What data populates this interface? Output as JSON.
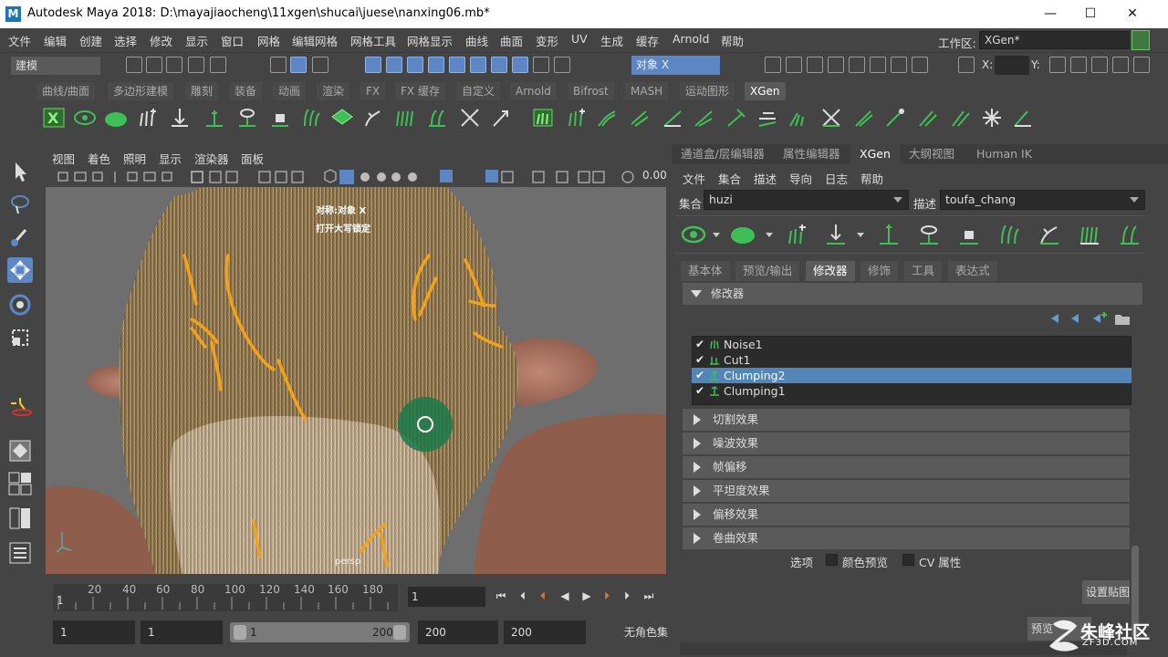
{
  "window": {
    "logo_letter": "M",
    "title": "Autodesk Maya 2018: D:\\mayajiaocheng\\11xgen\\shucai\\juese\\nanxing06.mb*",
    "minimize": "—",
    "maximize": "☐",
    "close": "✕"
  },
  "menubar": {
    "items": [
      "文件",
      "编辑",
      "创建",
      "选择",
      "修改",
      "显示",
      "窗口",
      "网格",
      "编辑网格",
      "网格工具",
      "网格显示",
      "曲线",
      "曲面",
      "变形",
      "UV",
      "生成",
      "缓存",
      "Arnold",
      "帮助"
    ],
    "workspace_label": "工作区:",
    "workspace_value": "XGen*"
  },
  "statusline": {
    "mode": "建模",
    "object_field": "对象 X",
    "x_label": "X:",
    "y_label": "Y:"
  },
  "shelf": {
    "tabs": [
      "曲线/曲面",
      "多边形建模",
      "雕刻",
      "装备",
      "动画",
      "渲染",
      "FX",
      "FX 缓存",
      "自定义",
      "Arnold",
      "Bifrost",
      "MASH",
      "运动图形",
      "XGen"
    ],
    "active_tab": "XGen"
  },
  "viewport": {
    "menu": [
      "视图",
      "着色",
      "照明",
      "显示",
      "渲染器",
      "面板"
    ],
    "zoom_value": "0.00",
    "hud_line1": "对称:对象 X",
    "hud_line2": "打开大写锁定",
    "camera_label": "persp"
  },
  "timeline": {
    "ticks": [
      "20",
      "40",
      "60",
      "80",
      "100",
      "120",
      "140",
      "160",
      "180"
    ],
    "start_marker": "1",
    "current_frame": "1"
  },
  "range": {
    "start": "1",
    "playback_start": "1",
    "slider_start": "1",
    "slider_end": "200",
    "playback_end": "200",
    "end": "200",
    "character_set": "无角色集"
  },
  "right_panel": {
    "tabs": [
      "通道盒/层编辑器",
      "属性编辑器",
      "XGen",
      "大纲视图",
      "Human IK"
    ],
    "active_tab": "XGen",
    "menu": [
      "文件",
      "集合",
      "描述",
      "导向",
      "日志",
      "帮助"
    ],
    "collection_label": "集合",
    "collection_value": "huzi",
    "description_label": "描述",
    "description_value": "toufa_chang",
    "sub_tabs": [
      "基本体",
      "预览/输出",
      "修改器",
      "修饰",
      "工具",
      "表达式"
    ],
    "active_sub_tab": "修改器",
    "modifier_header": "修改器",
    "modifiers": [
      {
        "name": "Noise1",
        "checked": "✔",
        "selected": false
      },
      {
        "name": "Cut1",
        "checked": "✔",
        "selected": false
      },
      {
        "name": "Clumping2",
        "checked": "✔",
        "selected": true
      },
      {
        "name": "Clumping1",
        "checked": "✔",
        "selected": false
      }
    ],
    "sections": [
      "切割效果",
      "噪波效果",
      "帧偏移",
      "平坦度效果",
      "偏移效果",
      "卷曲效果"
    ],
    "options_label": "选项",
    "color_preview_label": "颜色预览",
    "cv_attr_label": "CV 属性",
    "set_map_button": "设置贴图",
    "preview_button": "预览"
  },
  "watermark": {
    "text": "朱峰社区",
    "url": "ZF3D.COM"
  },
  "colors": {
    "accent_blue": "#5d87c4",
    "selection_blue": "#5285b8",
    "xgen_green": "#3fbf55",
    "guide_orange": "#f2a11a"
  }
}
